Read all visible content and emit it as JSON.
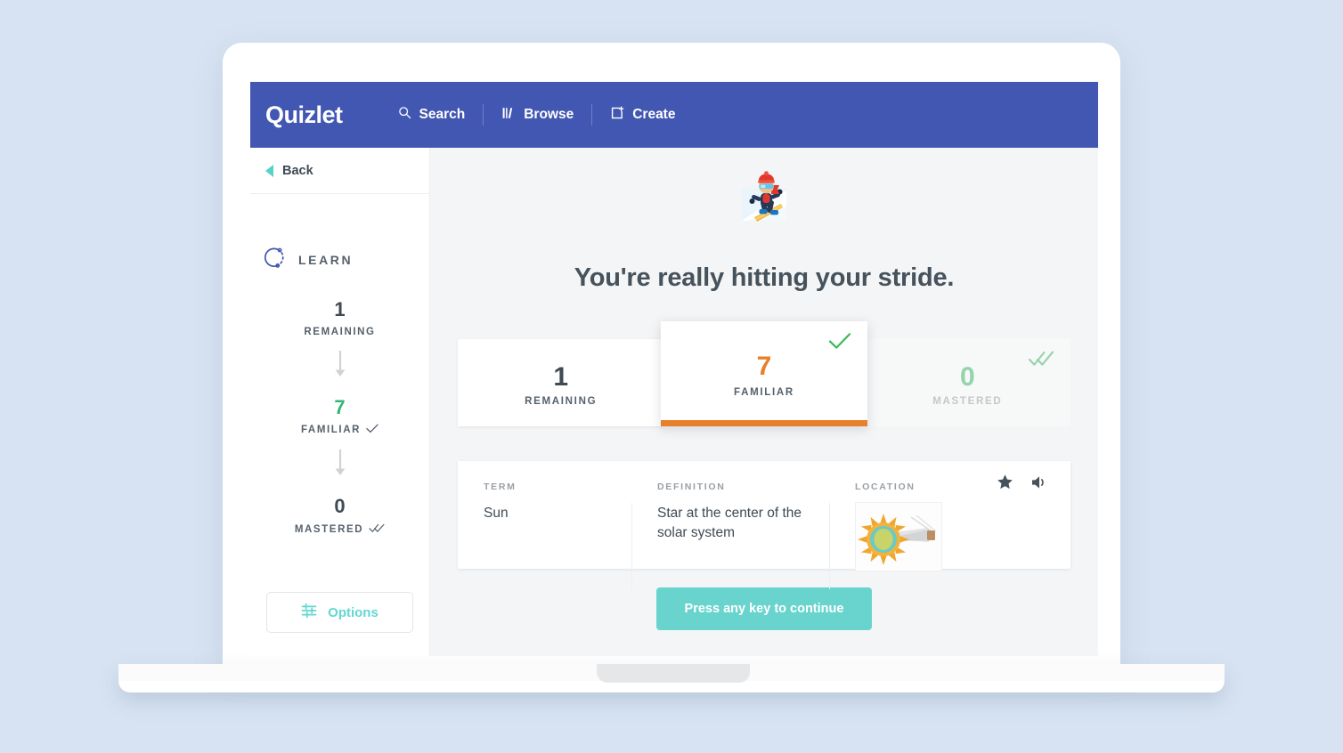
{
  "nav": {
    "brand": "Quizlet",
    "items": [
      {
        "label": "Search",
        "icon": "search-icon"
      },
      {
        "label": "Browse",
        "icon": "browse-icon"
      },
      {
        "label": "Create",
        "icon": "create-icon"
      }
    ]
  },
  "sidebar": {
    "back_label": "Back",
    "mode_label": "LEARN",
    "mode_icon": "learn-circle-icon",
    "progress": [
      {
        "value": "1",
        "label": "REMAINING",
        "color": "#3f4a54",
        "tick": "none"
      },
      {
        "value": "7",
        "label": "FAMILIAR",
        "color": "#32b67a",
        "tick": "single-check"
      },
      {
        "value": "0",
        "label": "MASTERED",
        "color": "#3f4a54",
        "tick": "double-check"
      }
    ],
    "options_label": "Options",
    "options_icon": "sliders-icon"
  },
  "main": {
    "hero_emoji": "snowboarder-emoji",
    "headline": "You're really hitting your stride.",
    "cards": [
      {
        "value": "1",
        "label": "REMAINING",
        "state": "default",
        "tick": "none"
      },
      {
        "value": "7",
        "label": "FAMILIAR",
        "state": "active",
        "tick": "single-check"
      },
      {
        "value": "0",
        "label": "MASTERED",
        "state": "muted",
        "tick": "double-check"
      }
    ],
    "term_row": {
      "headers": {
        "term": "TERM",
        "definition": "DEFINITION",
        "location": "LOCATION"
      },
      "term": "Sun",
      "definition": "Star at the center of the solar system",
      "location_image": "sun-diagram-image",
      "star_icon": "star-icon",
      "audio_icon": "speaker-icon"
    },
    "continue_label": "Press any key to continue"
  },
  "colors": {
    "brand_blue": "#4257b2",
    "teal": "#69d4cd",
    "orange": "#e8802b",
    "green": "#32b67a",
    "page_bg": "#d7e3f2"
  }
}
